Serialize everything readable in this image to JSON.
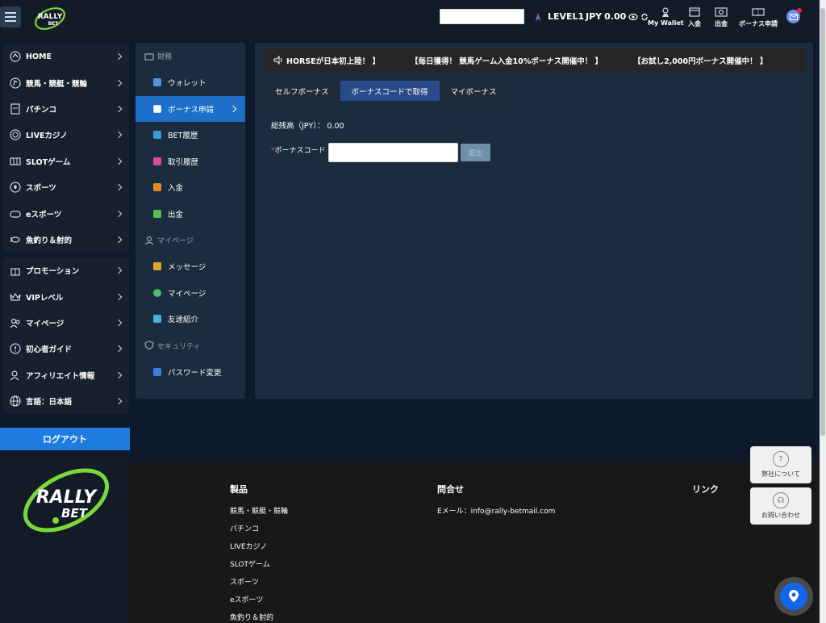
{
  "header": {
    "search_value": "",
    "level": "LEVEL1",
    "currency": "JPY",
    "balance": "0.00",
    "items": [
      {
        "label": "My Wallet",
        "icon": "wallet-icon"
      },
      {
        "label": "入金",
        "icon": "deposit-icon"
      },
      {
        "label": "出金",
        "icon": "withdraw-icon"
      },
      {
        "label": "ボーナス申請",
        "icon": "ticket-icon"
      }
    ]
  },
  "leftnav": {
    "group1": [
      {
        "label": "HOME",
        "icon": "home-icon"
      },
      {
        "label": "競馬・競艇・競輪",
        "icon": "horse-icon"
      },
      {
        "label": "パチンコ",
        "icon": "pachinko-icon"
      },
      {
        "label": "LIVEカジノ",
        "icon": "casino-chip-icon"
      },
      {
        "label": "SLOTゲーム",
        "icon": "slot-icon"
      },
      {
        "label": "スポーツ",
        "icon": "ball-icon"
      },
      {
        "label": "eスポーツ",
        "icon": "gamepad-icon"
      },
      {
        "label": "魚釣り＆射的",
        "icon": "fish-icon"
      }
    ],
    "group2": [
      {
        "label": "プロモーション",
        "icon": "gift-icon"
      },
      {
        "label": "VIPレベル",
        "icon": "crown-icon"
      },
      {
        "label": "マイページ",
        "icon": "users-icon"
      },
      {
        "label": "初心者ガイド",
        "icon": "info-icon"
      },
      {
        "label": "アフィリエイト情報",
        "icon": "affiliate-icon"
      },
      {
        "label": "言語：日本語",
        "icon": "globe-icon"
      }
    ],
    "logout": "ログアウト"
  },
  "submenu": {
    "sec_finance": "財務",
    "wallet": "ウォレット",
    "bonus_apply": "ボーナス申請",
    "bet_history": "BET履歴",
    "transaction_history": "取引履歴",
    "deposit": "入金",
    "withdraw": "出金",
    "sec_mypage": "マイページ",
    "message": "メッセージ",
    "mypage": "マイページ",
    "referral": "友達紹介",
    "sec_security": "セキュリティ",
    "password_change": "パスワード変更"
  },
  "main": {
    "ticker": [
      "HORSEが日本初上陸！ 】",
      "【毎日獲得！ 競馬ゲーム入金10%ボーナス開催中！ 】",
      "【お試し2,000円ボーナス開催中！ 】"
    ],
    "tabs": [
      "セルフボーナス",
      "ボーナスコードで取得",
      "マイボーナス"
    ],
    "balance_text": "総残高（JPY）： 0.00",
    "code_label": "ボーナスコード",
    "code_value": "",
    "submit": "提出"
  },
  "footer": {
    "products_title": "製品",
    "products": [
      "競馬・競艇・競輪",
      "パチンコ",
      "LIVEカジノ",
      "SLOTゲーム",
      "スポーツ",
      "eスポーツ",
      "魚釣り＆射的"
    ],
    "contact_title": "問合せ",
    "email": "Eメール：info@rally-betmail.com",
    "links_title": "リンク"
  },
  "float": {
    "about": "弊社について",
    "contact": "お問い合わせ"
  },
  "colors": {
    "accent": "#1d6fc9",
    "logout": "#1e7be0",
    "logo_green": "#7cd83a"
  }
}
